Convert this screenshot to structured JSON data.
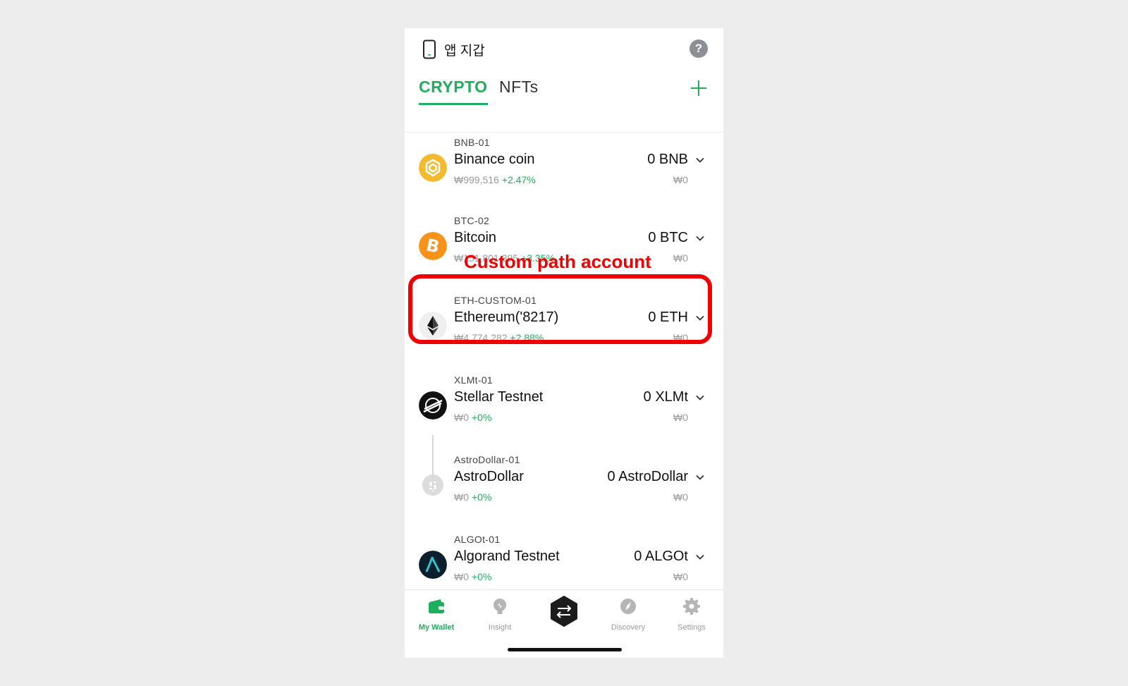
{
  "header": {
    "title": "앱 지갑",
    "help_label": "?"
  },
  "tabs": [
    {
      "label": "CRYPTO"
    },
    {
      "label": "NFTs"
    }
  ],
  "annotation": {
    "label": "Custom path account"
  },
  "accounts": [
    {
      "id": "BNB-01",
      "name": "Binance coin",
      "price": "₩999,516",
      "change": "+2.47%",
      "balance": "0 BNB",
      "fiat": "₩0",
      "icon": "bnb-icon"
    },
    {
      "id": "BTC-02",
      "name": "Bitcoin",
      "price": "₩151,801,395",
      "change": "+3.35%",
      "balance": "0 BTC",
      "fiat": "₩0",
      "icon": "bitcoin-icon"
    },
    {
      "id": "ETH-CUSTOM-01",
      "name": "Ethereum('8217)",
      "price": "₩4,774,282",
      "change": "+2.88%",
      "balance": "0 ETH",
      "fiat": "₩0",
      "icon": "ethereum-icon"
    },
    {
      "id": "XLMt-01",
      "name": "Stellar Testnet",
      "price": "₩0",
      "change": "+0%",
      "balance": "0 XLMt",
      "fiat": "₩0",
      "icon": "stellar-icon"
    },
    {
      "id": "AstroDollar-01",
      "name": "AstroDollar",
      "price": "₩0",
      "change": "+0%",
      "balance": "0 AstroDollar",
      "fiat": "₩0",
      "icon": "dollar-icon"
    },
    {
      "id": "ALGOt-01",
      "name": "Algorand Testnet",
      "price": "₩0",
      "change": "+0%",
      "balance": "0 ALGOt",
      "fiat": "₩0",
      "icon": "algorand-icon"
    }
  ],
  "nav": [
    {
      "label": "My Wallet",
      "icon": "wallet-icon",
      "active": true
    },
    {
      "label": "Insight",
      "icon": "lightbulb-icon"
    },
    {
      "label": "",
      "icon": "swap-icon"
    },
    {
      "label": "Discovery",
      "icon": "compass-icon"
    },
    {
      "label": "Settings",
      "icon": "gear-icon"
    }
  ],
  "colors": {
    "accent": "#1fae5d",
    "annotation": "#ee0000"
  }
}
